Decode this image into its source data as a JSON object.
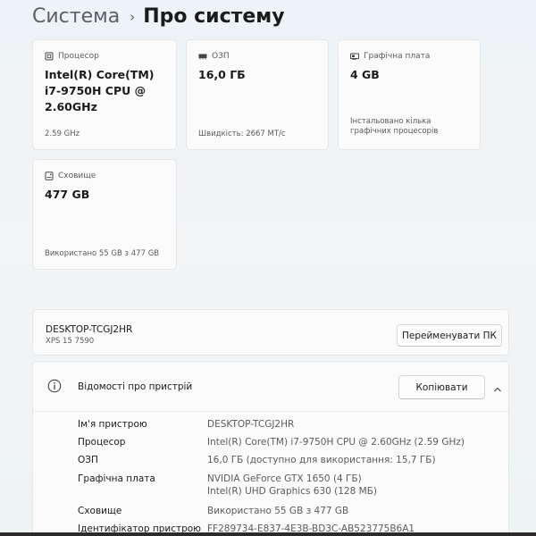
{
  "breadcrumb": {
    "parent": "Система",
    "separator": "›",
    "current": "Про систему"
  },
  "cards": {
    "cpu": {
      "label": "Процесор",
      "icon": "cpu-icon",
      "value": "Intel(R) Core(TM) i7-9750H CPU @ 2.60GHz",
      "sub": "2.59 GHz"
    },
    "ram": {
      "label": "ОЗП",
      "icon": "ram-icon",
      "value": "16,0 ГБ",
      "sub": "Швидкість: 2667 МТ/с"
    },
    "gpu": {
      "label": "Графічна плата",
      "icon": "gpu-icon",
      "value": "4 GB",
      "sub": "Інстальовано кілька графічних процесорів"
    },
    "storage": {
      "label": "Сховище",
      "icon": "storage-icon",
      "value": "477 GB",
      "sub": "Використано 55 GB з 477 GB"
    }
  },
  "device": {
    "name": "DESKTOP-TCGJ2HR",
    "model": "XPS 15 7590",
    "rename_label": "Перейменувати ПК"
  },
  "device_info": {
    "title": "Відомості про пристрій",
    "copy_label": "Копіювати",
    "specs": [
      {
        "key": "Ім'я пристрою",
        "value": "DESKTOP-TCGJ2HR"
      },
      {
        "key": "Процесор",
        "value": "Intel(R) Core(TM) i7-9750H CPU @ 2.60GHz (2.59 GHz)"
      },
      {
        "key": "ОЗП",
        "value": "16,0 ГБ (доступно для використання: 15,7 ГБ)"
      },
      {
        "key": "Графічна плата",
        "value": "NVIDIA GeForce GTX 1650 (4 ГБ)",
        "value2": "Intel(R) UHD Graphics 630 (128 МБ)"
      },
      {
        "key": "Сховище",
        "value": "Використано 55 GB з 477 GB"
      },
      {
        "key": "Ідентифікатор пристрою",
        "value": "FF289734-E837-4E3B-BD3C-AB523775B6A1"
      }
    ]
  }
}
